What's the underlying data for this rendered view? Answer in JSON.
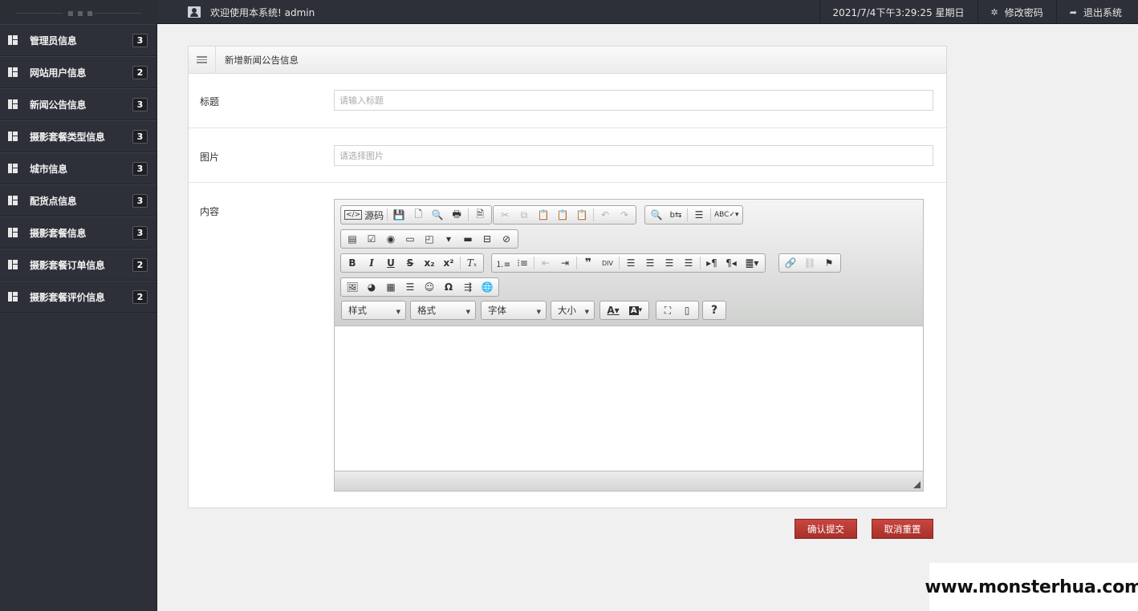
{
  "header": {
    "welcome_text": "欢迎使用本系统! admin",
    "datetime": "2021/7/4下午3:29:25 星期日",
    "change_password": "修改密码",
    "logout": "退出系统",
    "sidebar_handle": "■ ■ ■"
  },
  "sidebar": {
    "items": [
      {
        "label": "管理员信息",
        "count": "3"
      },
      {
        "label": "网站用户信息",
        "count": "2"
      },
      {
        "label": "新闻公告信息",
        "count": "3"
      },
      {
        "label": "摄影套餐类型信息",
        "count": "3"
      },
      {
        "label": "城市信息",
        "count": "3"
      },
      {
        "label": "配货点信息",
        "count": "3"
      },
      {
        "label": "摄影套餐信息",
        "count": "3"
      },
      {
        "label": "摄影套餐订单信息",
        "count": "2"
      },
      {
        "label": "摄影套餐评价信息",
        "count": "2"
      }
    ]
  },
  "form": {
    "panel_title": "新增新闻公告信息",
    "title_label": "标题",
    "title_placeholder": "请输入标题",
    "image_label": "图片",
    "image_placeholder": "请选择图片",
    "content_label": "内容"
  },
  "editor": {
    "source_label": "源码",
    "style_combo": "样式",
    "format_combo": "格式",
    "font_combo": "字体",
    "size_combo": "大小",
    "help_label": "?"
  },
  "actions": {
    "submit": "确认提交",
    "reset": "取消重置"
  },
  "watermark": "www.monsterhua.com"
}
